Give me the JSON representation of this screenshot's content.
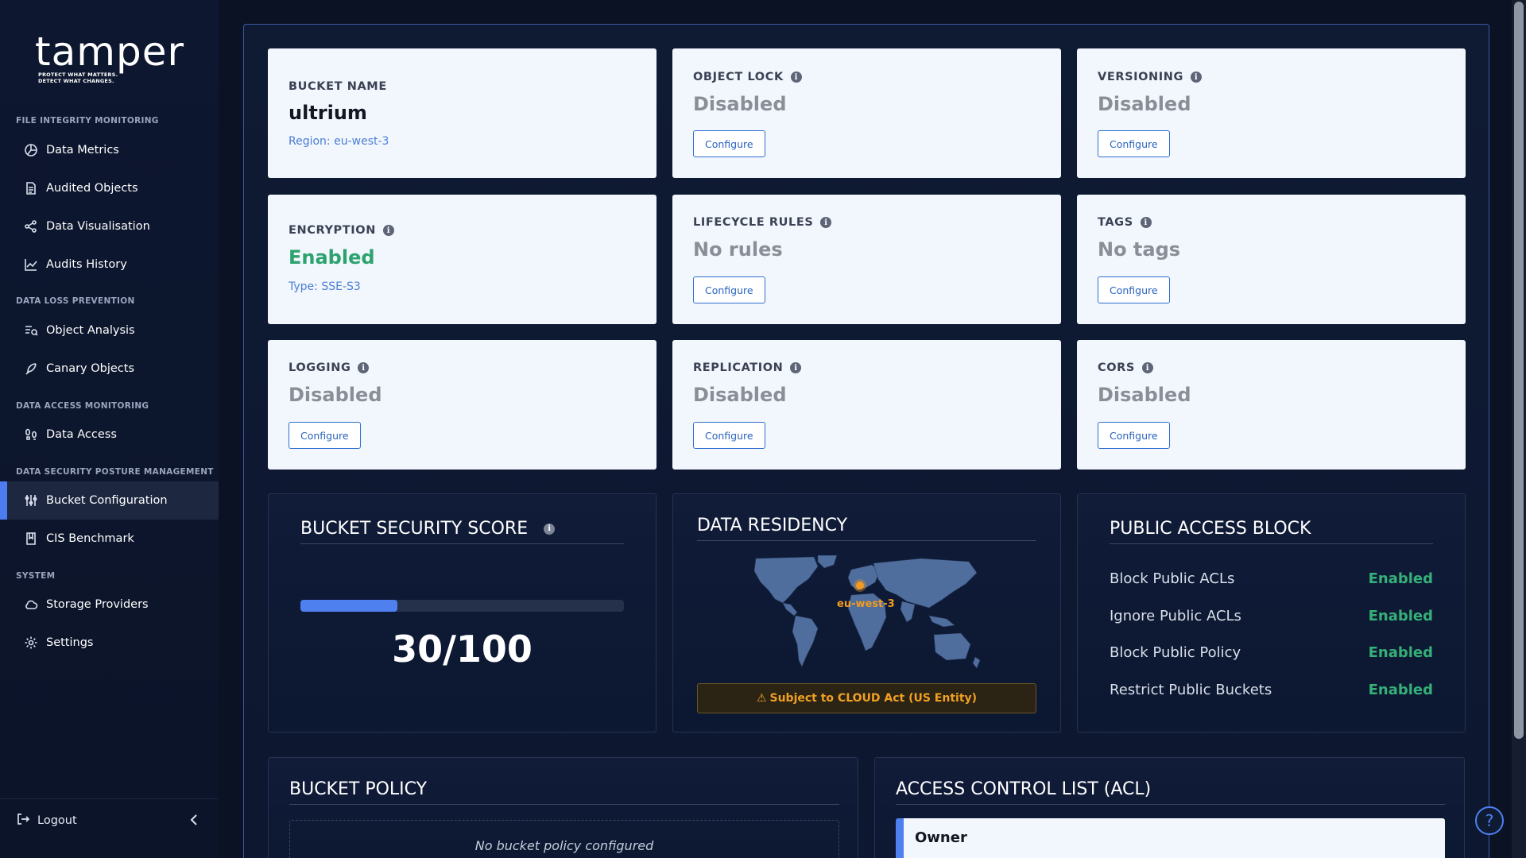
{
  "brand": {
    "name": "tamper",
    "tagline_line1": "PROTECT WHAT MATTERS.",
    "tagline_line2": "DETECT WHAT CHANGES."
  },
  "sidebar": {
    "sections": [
      {
        "label": "FILE INTEGRITY MONITORING"
      },
      {
        "label": "DATA LOSS PREVENTION"
      },
      {
        "label": "DATA ACCESS MONITORING"
      },
      {
        "label": "DATA SECURITY POSTURE MANAGEMENT"
      },
      {
        "label": "SYSTEM"
      }
    ],
    "items": [
      {
        "label": "Data Metrics",
        "icon": "pie-chart-icon"
      },
      {
        "label": "Audited Objects",
        "icon": "document-icon"
      },
      {
        "label": "Data Visualisation",
        "icon": "graph-nodes-icon"
      },
      {
        "label": "Audits History",
        "icon": "line-chart-icon"
      },
      {
        "label": "Object Analysis",
        "icon": "list-search-icon"
      },
      {
        "label": "Canary Objects",
        "icon": "feather-icon"
      },
      {
        "label": "Data Access",
        "icon": "footprints-icon"
      },
      {
        "label": "Bucket Configuration",
        "icon": "sliders-icon",
        "active": true
      },
      {
        "label": "CIS Benchmark",
        "icon": "book-icon"
      },
      {
        "label": "Storage Providers",
        "icon": "cloud-icon"
      },
      {
        "label": "Settings",
        "icon": "gear-icon"
      }
    ],
    "logout_label": "Logout"
  },
  "cards": {
    "bucket_name": {
      "label": "BUCKET NAME",
      "value": "ultrium",
      "sub": "Region: eu-west-3"
    },
    "object_lock": {
      "label": "OBJECT LOCK",
      "value": "Disabled",
      "button": "Configure"
    },
    "versioning": {
      "label": "VERSIONING",
      "value": "Disabled",
      "button": "Configure"
    },
    "encryption": {
      "label": "ENCRYPTION",
      "value": "Enabled",
      "sub": "Type: SSE-S3"
    },
    "lifecycle": {
      "label": "LIFECYCLE RULES",
      "value": "No rules",
      "button": "Configure"
    },
    "tags": {
      "label": "TAGS",
      "value": "No tags",
      "button": "Configure"
    },
    "logging": {
      "label": "LOGGING",
      "value": "Disabled",
      "button": "Configure"
    },
    "replication": {
      "label": "REPLICATION",
      "value": "Disabled",
      "button": "Configure"
    },
    "cors": {
      "label": "CORS",
      "value": "Disabled",
      "button": "Configure"
    }
  },
  "score": {
    "title": "BUCKET SECURITY SCORE",
    "value_text": "30/100",
    "fraction": 0.3
  },
  "residency": {
    "title": "DATA RESIDENCY",
    "region_label": "eu-west-3",
    "warning": "Subject to CLOUD Act (US Entity)"
  },
  "public_access_block": {
    "title": "PUBLIC ACCESS BLOCK",
    "rows": [
      {
        "name": "Block Public ACLs",
        "status": "Enabled"
      },
      {
        "name": "Ignore Public ACLs",
        "status": "Enabled"
      },
      {
        "name": "Block Public Policy",
        "status": "Enabled"
      },
      {
        "name": "Restrict Public Buckets",
        "status": "Enabled"
      }
    ]
  },
  "bucket_policy": {
    "title": "BUCKET POLICY",
    "empty_text": "No bucket policy configured"
  },
  "acl": {
    "title": "ACCESS CONTROL LIST (ACL)",
    "owner_label": "Owner"
  },
  "colors": {
    "accent": "#4f80ef",
    "enabled": "#2ca36e",
    "warning": "#f0a022"
  }
}
